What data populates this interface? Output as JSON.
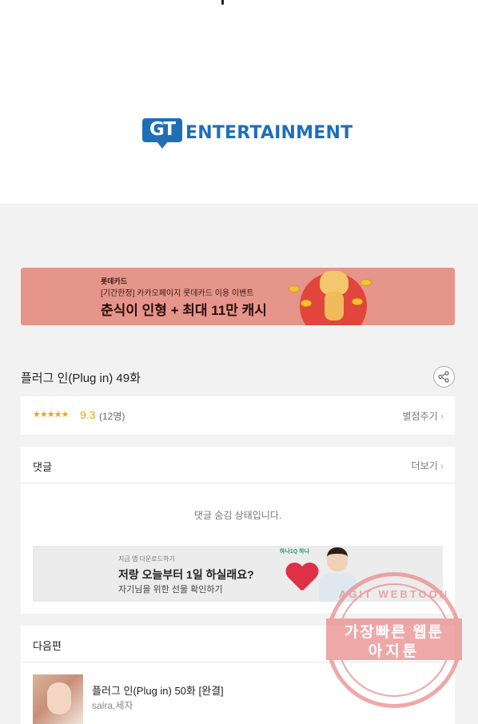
{
  "brand": {
    "logo_mark": "GT",
    "logo_text": "ENTERTAINMENT"
  },
  "banner": {
    "brand": "롯데카드",
    "subtitle": "[기간한정] 카카오페이지 롯데카드 이용 이벤트",
    "title": "춘식이 인형 + 최대 11만 캐시",
    "bg_color": "#e5958a"
  },
  "episode": {
    "title": "플러그 인(Plug in) 49화",
    "share_icon": "share-icon"
  },
  "rating": {
    "stars": "★★★★★",
    "score": "9.3",
    "count": "(12명)",
    "rate_link": "별점주기",
    "accent_color": "#f0a30a"
  },
  "comments": {
    "header": "댓글",
    "more": "더보기",
    "hidden_message": "댓글 숨김 상태입니다."
  },
  "ad": {
    "small_text": "지금 앱 다운로드하기",
    "title": "저랑 오늘부터 1일 하실래요?",
    "subtitle": "자기님을 위한 선물 확인하기",
    "logo": "하나1Q 하나"
  },
  "next": {
    "header": "다음편",
    "item_title": "플러그 인(Plug in) 50화 [완결]",
    "item_author": "salra,세자"
  },
  "watermark": {
    "arc_text": "AGIT WEBTOON",
    "line1": "가장빠른 웹툰",
    "line2": "아지툰"
  }
}
